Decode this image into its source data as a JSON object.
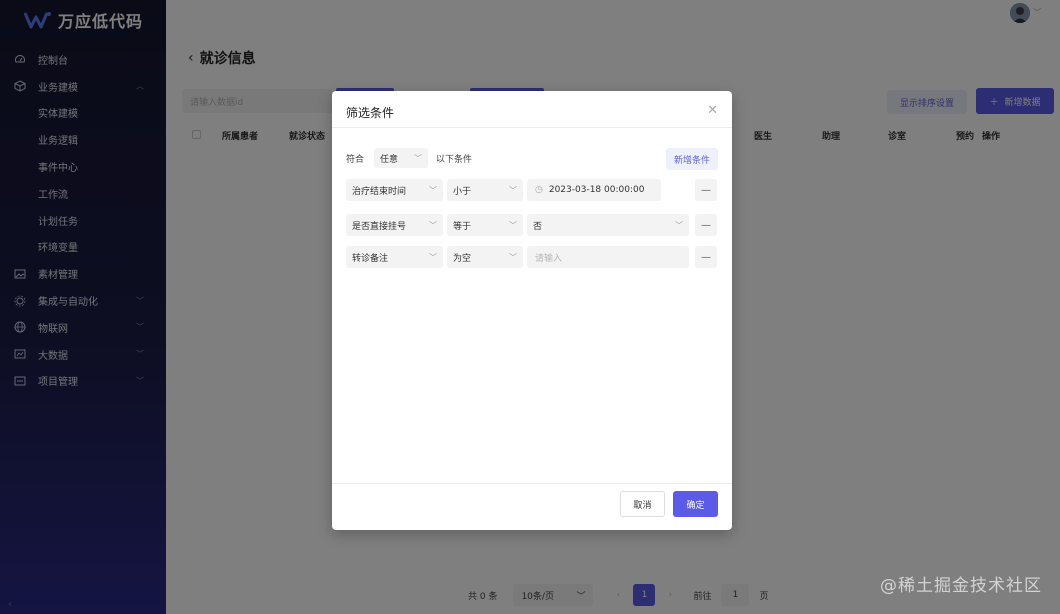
{
  "brand": {
    "name": "万应低代码"
  },
  "sidebar": {
    "items": [
      {
        "label": "控制台",
        "icon": "dashboard-icon",
        "expandable": false
      },
      {
        "label": "业务建模",
        "icon": "cube-icon",
        "expandable": true,
        "expanded": true,
        "children": [
          "实体建模",
          "业务逻辑",
          "事件中心",
          "工作流",
          "计划任务",
          "环境变量"
        ]
      },
      {
        "label": "素材管理",
        "icon": "image-icon",
        "expandable": false
      },
      {
        "label": "集成与自动化",
        "icon": "automation-icon",
        "expandable": true
      },
      {
        "label": "物联网",
        "icon": "globe-icon",
        "expandable": true
      },
      {
        "label": "大数据",
        "icon": "bigdata-icon",
        "expandable": true
      },
      {
        "label": "项目管理",
        "icon": "project-icon",
        "expandable": true
      }
    ]
  },
  "page": {
    "title": "就诊信息",
    "search_placeholder": "请输入数据id",
    "sort_button": "显示排序设置",
    "add_button": "新增数据",
    "table_headers": [
      "所属患者",
      "就诊状态",
      "医生",
      "助理",
      "诊室",
      "预约",
      "操作"
    ]
  },
  "pagination": {
    "total": "共 0 条",
    "page_size": "10条/页",
    "current_page": "1",
    "goto_label": "前往",
    "goto_value": "1",
    "page_suffix": "页"
  },
  "modal": {
    "title": "筛选条件",
    "match_prefix": "符合",
    "match_value": "任意",
    "match_suffix": "以下条件",
    "add_condition": "新增条件",
    "conditions": [
      {
        "field": "治疗结束时间",
        "operator": "小于",
        "value": "2023-03-18 00:00:00",
        "value_type": "datetime"
      },
      {
        "field": "是否直接挂号",
        "operator": "等于",
        "value": "否",
        "value_type": "select"
      },
      {
        "field": "转诊备注",
        "operator": "为空",
        "value": "",
        "placeholder": "请输入",
        "value_type": "text"
      }
    ],
    "minus_symbol": "—",
    "cancel": "取消",
    "confirm": "确定"
  },
  "watermark": "@稀土掘金技术社区",
  "colors": {
    "accent": "#5b5be8",
    "sidebar_top": "#15162e",
    "sidebar_bottom": "#2a2a86"
  }
}
